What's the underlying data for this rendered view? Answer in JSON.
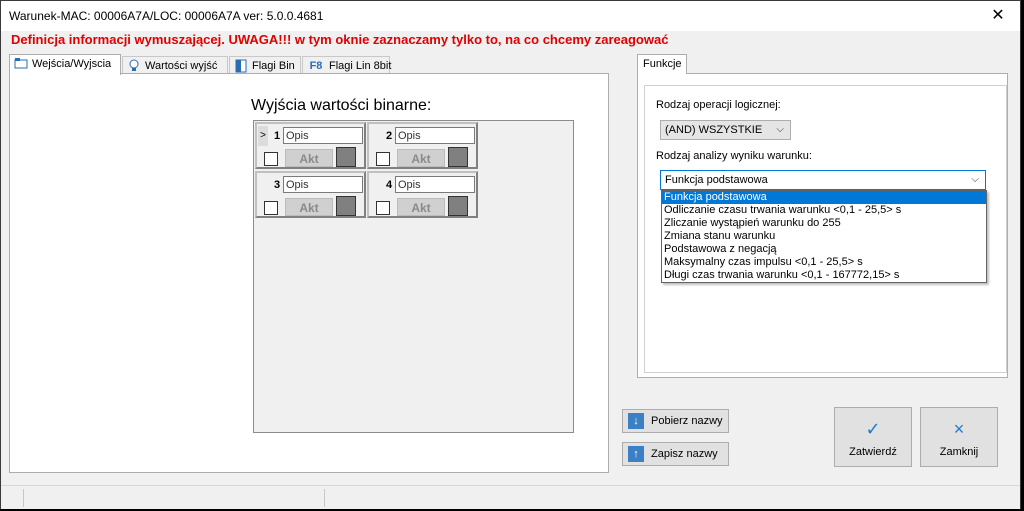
{
  "window": {
    "title": "Warunek-MAC: 00006A7A/LOC: 00006A7A ver: 5.0.0.4681",
    "close_glyph": "✕"
  },
  "warning": "Definicja informacji wymuszającej. UWAGA!!! w tym oknie zaznaczamy tylko to, na co chcemy zareagować",
  "tabs": [
    {
      "label": "Wejścia/Wyjscia",
      "icon": "tabs-icon"
    },
    {
      "label": "Wartości wyjść",
      "icon": "lightbulb-icon"
    },
    {
      "label": "Flagi Bin",
      "icon": "flag-bin-icon"
    },
    {
      "label": "Flagi Lin 8bit",
      "icon": "f8-icon",
      "icon_text": "F8"
    }
  ],
  "outputs": {
    "label": "Wyjścia wartości binarne:",
    "cells": [
      {
        "num": "1",
        "opis": "Opis",
        "akt": "Akt",
        "selected_marker": ">"
      },
      {
        "num": "2",
        "opis": "Opis",
        "akt": "Akt"
      },
      {
        "num": "3",
        "opis": "Opis",
        "akt": "Akt"
      },
      {
        "num": "4",
        "opis": "Opis",
        "akt": "Akt"
      }
    ]
  },
  "funkcje": {
    "tab_label": "Funkcje",
    "op_label": "Rodzaj operacji logicznej:",
    "op_value": "(AND) WSZYSTKIE",
    "analysis_label": "Rodzaj analizy wyniku warunku:",
    "analysis_value": "Funkcja podstawowa",
    "options": [
      "Funkcja podstawowa",
      "Odliczanie czasu trwania warunku <0,1 - 25,5> s",
      "Zliczanie wystąpień warunku do 255",
      "Zmiana stanu warunku",
      "Podstawowa z negacją",
      "Maksymalny czas impulsu <0,1 - 25,5> s",
      "Długi czas trwania warunku <0,1 - 167772,15> s"
    ]
  },
  "buttons": {
    "pobierz": "Pobierz nazwy",
    "zapisz": "Zapisz nazwy",
    "zatwierdz": "Zatwierdź",
    "zamknij": "Zamknij",
    "check_glyph": "✓",
    "x_glyph": "×"
  }
}
